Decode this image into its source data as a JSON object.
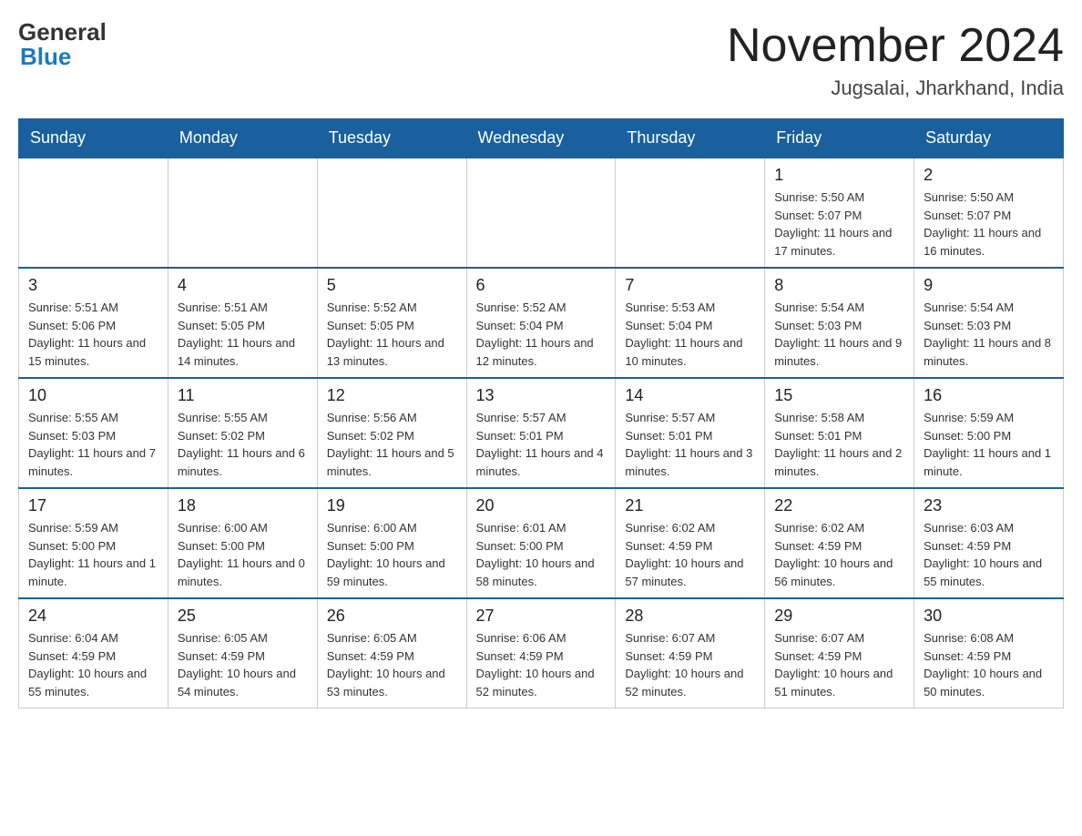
{
  "header": {
    "logo_general": "General",
    "logo_blue": "Blue",
    "month_title": "November 2024",
    "location": "Jugsalai, Jharkhand, India"
  },
  "days_of_week": [
    "Sunday",
    "Monday",
    "Tuesday",
    "Wednesday",
    "Thursday",
    "Friday",
    "Saturday"
  ],
  "weeks": [
    [
      {
        "day": "",
        "info": ""
      },
      {
        "day": "",
        "info": ""
      },
      {
        "day": "",
        "info": ""
      },
      {
        "day": "",
        "info": ""
      },
      {
        "day": "",
        "info": ""
      },
      {
        "day": "1",
        "info": "Sunrise: 5:50 AM\nSunset: 5:07 PM\nDaylight: 11 hours and 17 minutes."
      },
      {
        "day": "2",
        "info": "Sunrise: 5:50 AM\nSunset: 5:07 PM\nDaylight: 11 hours and 16 minutes."
      }
    ],
    [
      {
        "day": "3",
        "info": "Sunrise: 5:51 AM\nSunset: 5:06 PM\nDaylight: 11 hours and 15 minutes."
      },
      {
        "day": "4",
        "info": "Sunrise: 5:51 AM\nSunset: 5:05 PM\nDaylight: 11 hours and 14 minutes."
      },
      {
        "day": "5",
        "info": "Sunrise: 5:52 AM\nSunset: 5:05 PM\nDaylight: 11 hours and 13 minutes."
      },
      {
        "day": "6",
        "info": "Sunrise: 5:52 AM\nSunset: 5:04 PM\nDaylight: 11 hours and 12 minutes."
      },
      {
        "day": "7",
        "info": "Sunrise: 5:53 AM\nSunset: 5:04 PM\nDaylight: 11 hours and 10 minutes."
      },
      {
        "day": "8",
        "info": "Sunrise: 5:54 AM\nSunset: 5:03 PM\nDaylight: 11 hours and 9 minutes."
      },
      {
        "day": "9",
        "info": "Sunrise: 5:54 AM\nSunset: 5:03 PM\nDaylight: 11 hours and 8 minutes."
      }
    ],
    [
      {
        "day": "10",
        "info": "Sunrise: 5:55 AM\nSunset: 5:03 PM\nDaylight: 11 hours and 7 minutes."
      },
      {
        "day": "11",
        "info": "Sunrise: 5:55 AM\nSunset: 5:02 PM\nDaylight: 11 hours and 6 minutes."
      },
      {
        "day": "12",
        "info": "Sunrise: 5:56 AM\nSunset: 5:02 PM\nDaylight: 11 hours and 5 minutes."
      },
      {
        "day": "13",
        "info": "Sunrise: 5:57 AM\nSunset: 5:01 PM\nDaylight: 11 hours and 4 minutes."
      },
      {
        "day": "14",
        "info": "Sunrise: 5:57 AM\nSunset: 5:01 PM\nDaylight: 11 hours and 3 minutes."
      },
      {
        "day": "15",
        "info": "Sunrise: 5:58 AM\nSunset: 5:01 PM\nDaylight: 11 hours and 2 minutes."
      },
      {
        "day": "16",
        "info": "Sunrise: 5:59 AM\nSunset: 5:00 PM\nDaylight: 11 hours and 1 minute."
      }
    ],
    [
      {
        "day": "17",
        "info": "Sunrise: 5:59 AM\nSunset: 5:00 PM\nDaylight: 11 hours and 1 minute."
      },
      {
        "day": "18",
        "info": "Sunrise: 6:00 AM\nSunset: 5:00 PM\nDaylight: 11 hours and 0 minutes."
      },
      {
        "day": "19",
        "info": "Sunrise: 6:00 AM\nSunset: 5:00 PM\nDaylight: 10 hours and 59 minutes."
      },
      {
        "day": "20",
        "info": "Sunrise: 6:01 AM\nSunset: 5:00 PM\nDaylight: 10 hours and 58 minutes."
      },
      {
        "day": "21",
        "info": "Sunrise: 6:02 AM\nSunset: 4:59 PM\nDaylight: 10 hours and 57 minutes."
      },
      {
        "day": "22",
        "info": "Sunrise: 6:02 AM\nSunset: 4:59 PM\nDaylight: 10 hours and 56 minutes."
      },
      {
        "day": "23",
        "info": "Sunrise: 6:03 AM\nSunset: 4:59 PM\nDaylight: 10 hours and 55 minutes."
      }
    ],
    [
      {
        "day": "24",
        "info": "Sunrise: 6:04 AM\nSunset: 4:59 PM\nDaylight: 10 hours and 55 minutes."
      },
      {
        "day": "25",
        "info": "Sunrise: 6:05 AM\nSunset: 4:59 PM\nDaylight: 10 hours and 54 minutes."
      },
      {
        "day": "26",
        "info": "Sunrise: 6:05 AM\nSunset: 4:59 PM\nDaylight: 10 hours and 53 minutes."
      },
      {
        "day": "27",
        "info": "Sunrise: 6:06 AM\nSunset: 4:59 PM\nDaylight: 10 hours and 52 minutes."
      },
      {
        "day": "28",
        "info": "Sunrise: 6:07 AM\nSunset: 4:59 PM\nDaylight: 10 hours and 52 minutes."
      },
      {
        "day": "29",
        "info": "Sunrise: 6:07 AM\nSunset: 4:59 PM\nDaylight: 10 hours and 51 minutes."
      },
      {
        "day": "30",
        "info": "Sunrise: 6:08 AM\nSunset: 4:59 PM\nDaylight: 10 hours and 50 minutes."
      }
    ]
  ]
}
